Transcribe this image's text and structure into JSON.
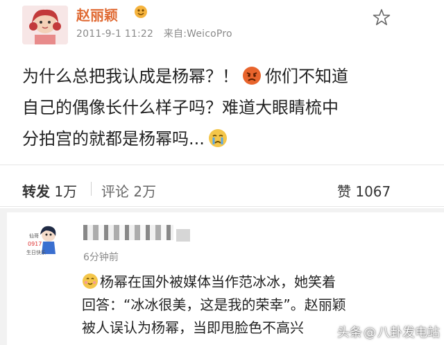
{
  "post": {
    "username": "赵丽颖",
    "date": "2011-9-1 11:22",
    "source": "来自:WeicoPro",
    "content_line1_a": "为什么总把我认成是杨幂？！",
    "content_line1_b": "你们不知道",
    "content_line2": "自己的偶像长什么样子吗？难道大眼睛梳中",
    "content_line3": "分拍宫的就都是杨幂吗..."
  },
  "actions": {
    "repost_label": "转发",
    "repost_count": "1万",
    "comment_label": "评论",
    "comment_count": "2万",
    "like_label": "赞",
    "like_count": "1067"
  },
  "comment": {
    "time": "6分钟前",
    "line1": "杨幂在国外被媒体当作范冰冰，她笑着",
    "line2": "回答：“冰冰很美，这是我的荣幸”。赵丽颖",
    "line3": "被人误认为杨幂，当即甩脸色不高兴"
  },
  "watermark": {
    "source": "头条",
    "at": "@",
    "account": "八卦发电站"
  },
  "colors": {
    "username": "#e06a33",
    "meta_gray": "#8a8a8a",
    "divider": "#e6e6e6",
    "band": "#f2f2f2"
  },
  "icons": [
    "star-icon",
    "vip-badge-icon",
    "angry-emoji-icon",
    "crying-emoji-icon",
    "smile-emoji-icon"
  ]
}
